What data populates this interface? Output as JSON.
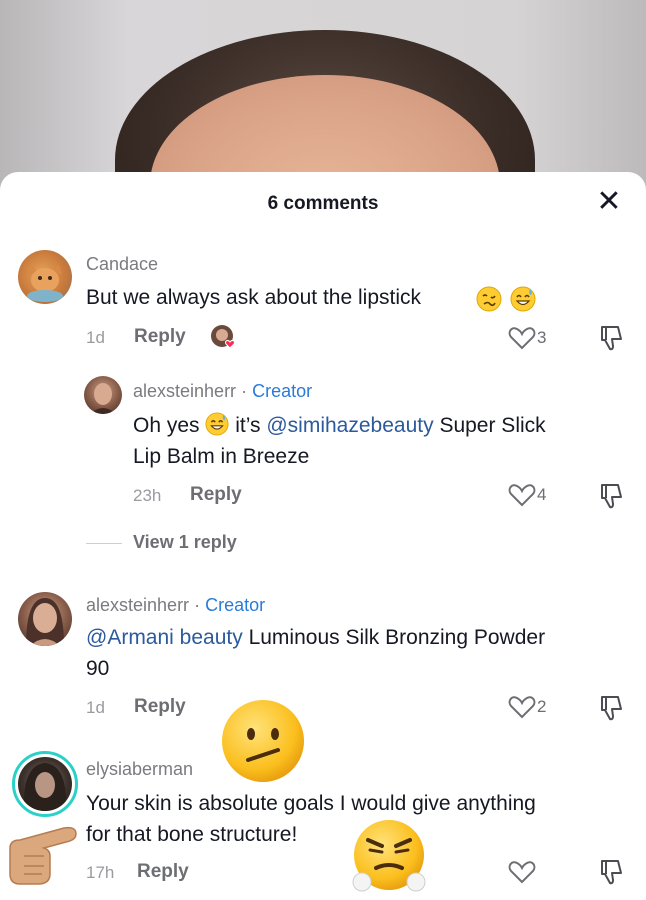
{
  "sheet": {
    "title": "6 comments",
    "close_symbol": "✕"
  },
  "comments": [
    {
      "username": "Candace",
      "text": "But we always ask about the lipstick",
      "time": "1d",
      "reply_label": "Reply",
      "likes": "3",
      "avatar_icon": "cat-avatar"
    },
    {
      "username": "alexsteinherr",
      "badge": "Creator",
      "text_part1": "Oh yes",
      "text_part2": "it’s",
      "mention": "@simihazebeauty",
      "text_line1_rest": "Super Slick",
      "text_line2": "Lip Balm in Breeze",
      "time": "23h",
      "reply_label": "Reply",
      "likes": "4"
    },
    {
      "view_replies": "View 1 reply"
    },
    {
      "username": "alexsteinherr",
      "badge": "Creator",
      "mention": "@Armani beauty",
      "text_line1_rest": "Luminous Silk Bronzing Powder",
      "text_line2": "90",
      "time": "1d",
      "reply_label": "Reply",
      "likes": "2"
    },
    {
      "username": "elysiaberman",
      "text_line1": "Your skin is absolute goals I would give anything",
      "text_line2": "for that bone structure!",
      "time": "17h",
      "reply_label": "Reply"
    }
  ],
  "separator": "·",
  "colors": {
    "creator": "#2a7bd9",
    "mention": "#2c5a9c",
    "story_ring": "#2bd1c9",
    "liked_heart": "#fe2c55"
  }
}
